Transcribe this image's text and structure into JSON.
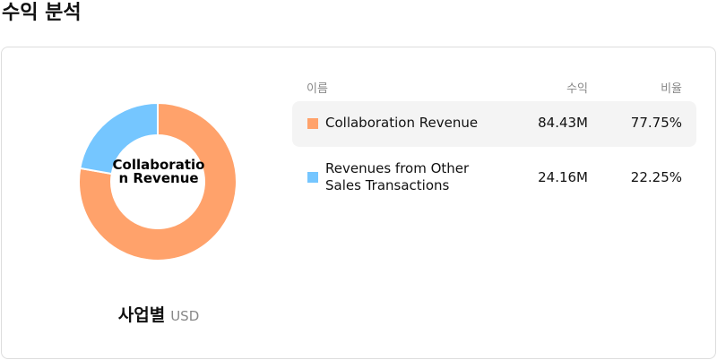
{
  "page": {
    "title": "수익 분석"
  },
  "chart_data": {
    "type": "pie",
    "donut": true,
    "center_label": "Collaboration Revenue",
    "caption": "사업별",
    "unit": "USD",
    "columns": {
      "name": "이름",
      "revenue": "수익",
      "ratio": "비율"
    },
    "slices": [
      {
        "name": "Collaboration Revenue",
        "revenue": "84.43M",
        "ratio": "77.75%",
        "value": 84.43,
        "percent": 77.75,
        "color": "#ffa26b",
        "selected": true
      },
      {
        "name": "Revenues from Other Sales Transactions",
        "revenue": "24.16M",
        "ratio": "22.25%",
        "value": 24.16,
        "percent": 22.25,
        "color": "#75c6ff",
        "selected": false
      }
    ]
  }
}
